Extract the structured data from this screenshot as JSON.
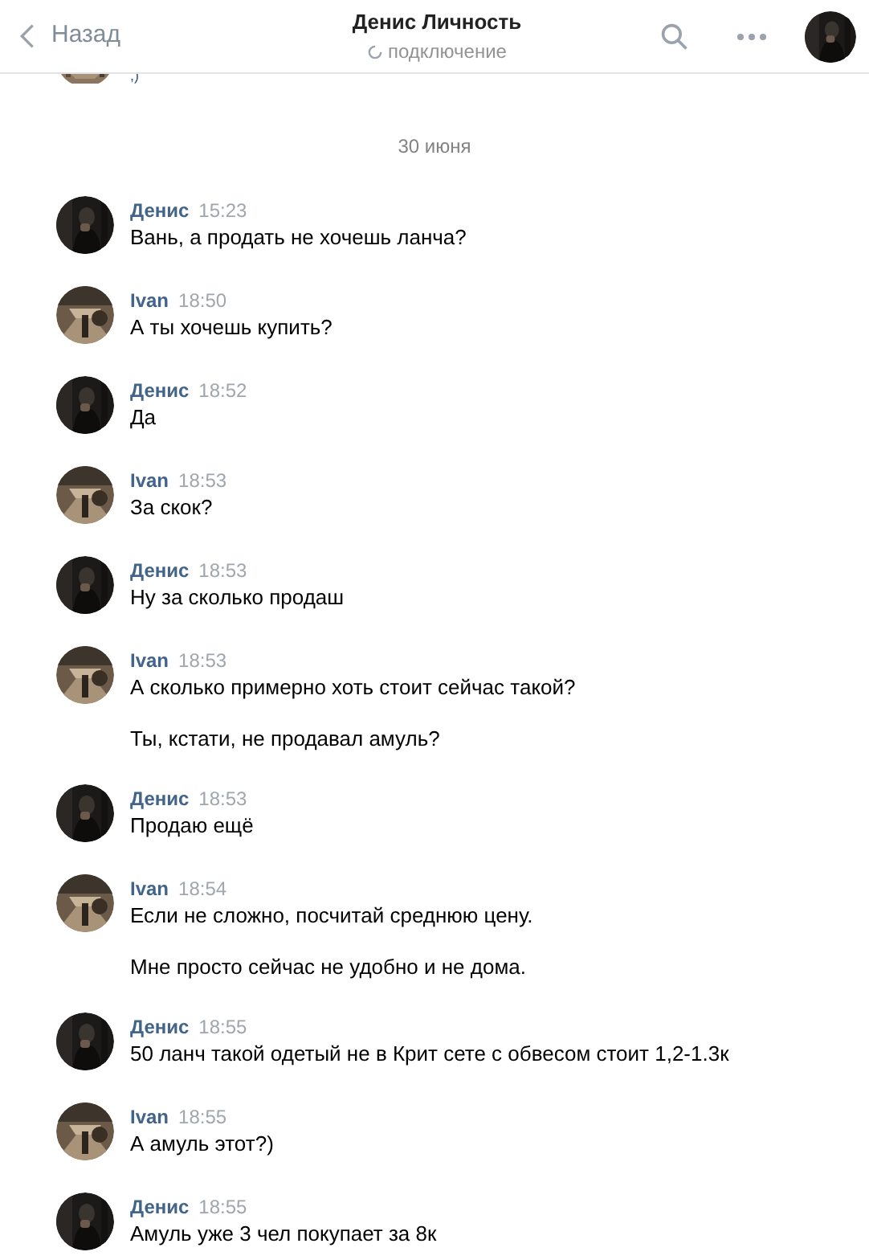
{
  "header": {
    "back": "Назад",
    "title": "Денис Личность",
    "status": "подключение"
  },
  "partial_message": {
    "text": ",)",
    "kind": "ivan"
  },
  "date_separator": "30 июня",
  "messages": [
    {
      "author": "Денис",
      "kind": "denis",
      "time": "15:23",
      "paragraphs": [
        "Вань, а продать не хочешь ланча?"
      ]
    },
    {
      "author": "Ivan",
      "kind": "ivan",
      "time": "18:50",
      "paragraphs": [
        "А ты хочешь купить?"
      ]
    },
    {
      "author": "Денис",
      "kind": "denis",
      "time": "18:52",
      "paragraphs": [
        "Да"
      ]
    },
    {
      "author": "Ivan",
      "kind": "ivan",
      "time": "18:53",
      "paragraphs": [
        "За скок?"
      ]
    },
    {
      "author": "Денис",
      "kind": "denis",
      "time": "18:53",
      "paragraphs": [
        "Ну за сколько продаш"
      ]
    },
    {
      "author": "Ivan",
      "kind": "ivan",
      "time": "18:53",
      "paragraphs": [
        "А сколько примерно хоть стоит сейчас такой?",
        "Ты, кстати, не продавал амуль?"
      ]
    },
    {
      "author": "Денис",
      "kind": "denis",
      "time": "18:53",
      "paragraphs": [
        "Продаю ещё"
      ]
    },
    {
      "author": "Ivan",
      "kind": "ivan",
      "time": "18:54",
      "paragraphs": [
        "Если не сложно, посчитай среднюю цену.",
        "Мне просто сейчас не удобно и не дома."
      ]
    },
    {
      "author": "Денис",
      "kind": "denis",
      "time": "18:55",
      "paragraphs": [
        "50 ланч такой одетый не в Крит сете с обвесом стоит 1,2-1.3к"
      ]
    },
    {
      "author": "Ivan",
      "kind": "ivan",
      "time": "18:55",
      "paragraphs": [
        "А амуль этот?)"
      ]
    },
    {
      "author": "Денис",
      "kind": "denis",
      "time": "18:55",
      "paragraphs": [
        "Амуль уже 3 чел покупает за 8к"
      ]
    }
  ]
}
